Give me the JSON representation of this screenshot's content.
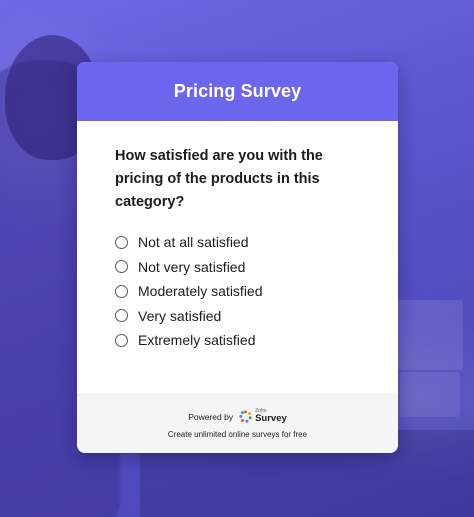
{
  "survey": {
    "title": "Pricing Survey",
    "question": "How satisfied are you with the pricing of the products in this category?",
    "options": [
      {
        "label": "Not at all satisfied",
        "selected": false
      },
      {
        "label": "Not very satisfied",
        "selected": false
      },
      {
        "label": "Moderately satisfied",
        "selected": false
      },
      {
        "label": "Very satisfied",
        "selected": false
      },
      {
        "label": "Extremely satisfied",
        "selected": false
      }
    ]
  },
  "footer": {
    "powered_by": "Powered by",
    "logo_brand": "Zoho",
    "logo_product": "Survey",
    "cta": "Create unlimited online surveys for free"
  },
  "colors": {
    "header": "#6c66ec",
    "background": "#5b55c8",
    "footer_bg": "#f5f5f6"
  }
}
